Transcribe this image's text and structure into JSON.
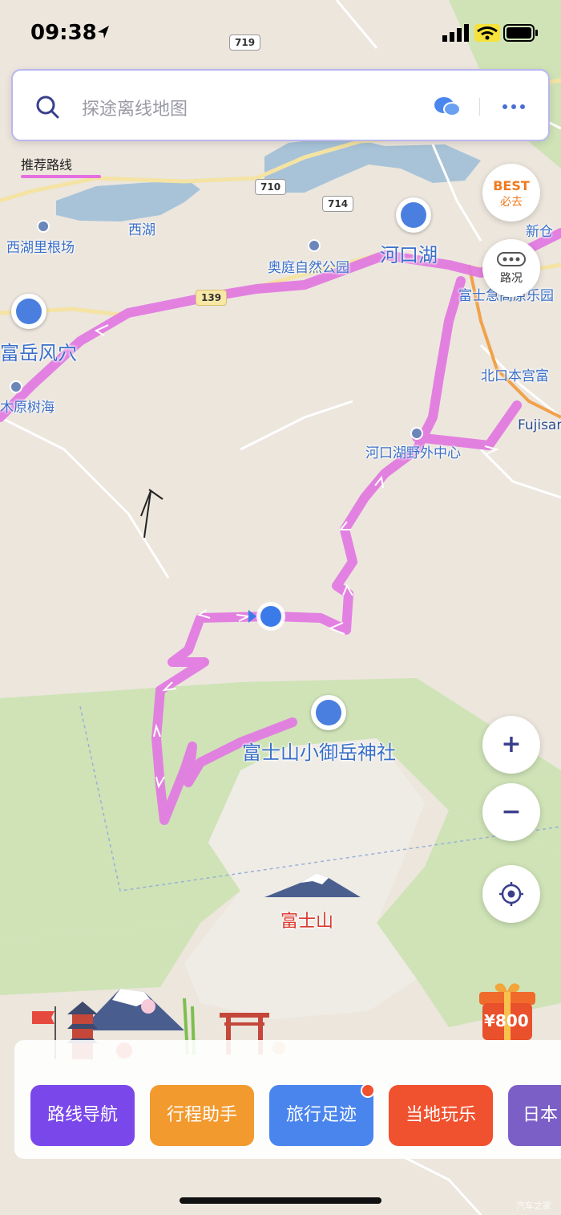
{
  "status_bar": {
    "time": "09:38"
  },
  "search": {
    "placeholder": "探途离线地图"
  },
  "legend": {
    "label": "推荐路线"
  },
  "route_color": "#e56fe0",
  "side_buttons": {
    "best": {
      "line1": "BEST",
      "line2": "必去"
    },
    "traffic": {
      "label": "路况"
    }
  },
  "road_numbers": [
    "719",
    "710",
    "714",
    "139"
  ],
  "places": {
    "saiko": "西湖",
    "saiko_nenba": "西湖里根场",
    "kawaguchiko": "河口湖",
    "okuniwa": "奥庭自然公园",
    "fugaku": "富岳风穴",
    "aokigahara": "木原树海",
    "fuji_q": "富士急高原乐园",
    "kitaguchi": "北口本宫富",
    "fujisan_station": "Fujisan",
    "shinkura": "新仓",
    "field_center": "河口湖野外中心",
    "komitake": "富士山小御岳神社",
    "mt_fuji": "富士山"
  },
  "zoom": {
    "in": "+",
    "out": "−"
  },
  "coupon": {
    "amount": "¥800"
  },
  "tiles": [
    {
      "label": "路线导航",
      "color": "#7a48ea"
    },
    {
      "label": "行程助手",
      "color": "#f29a2e"
    },
    {
      "label": "旅行足迹",
      "color": "#4a85ee"
    },
    {
      "label": "当地玩乐",
      "color": "#f0512e"
    },
    {
      "label": "日本",
      "color": "#7b5fc7"
    }
  ],
  "watermark": "汽车之家"
}
